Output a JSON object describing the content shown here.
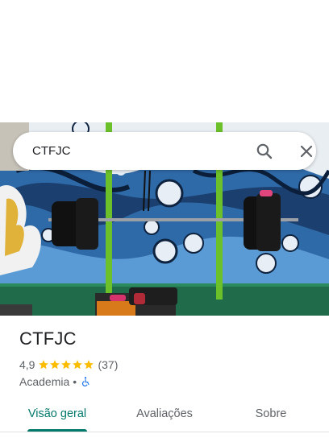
{
  "search": {
    "query": "CTFJC"
  },
  "place": {
    "name": "CTFJC",
    "rating": "4,9",
    "stars": 5,
    "review_count": "(37)",
    "category": "Academia",
    "separator": "•"
  },
  "tabs": [
    {
      "label": "Visão geral",
      "active": true
    },
    {
      "label": "Avaliações",
      "active": false
    },
    {
      "label": "Sobre",
      "active": false
    }
  ],
  "colors": {
    "accent": "#00796b",
    "star": "#fbbc04",
    "accessibility": "#1a73e8"
  }
}
